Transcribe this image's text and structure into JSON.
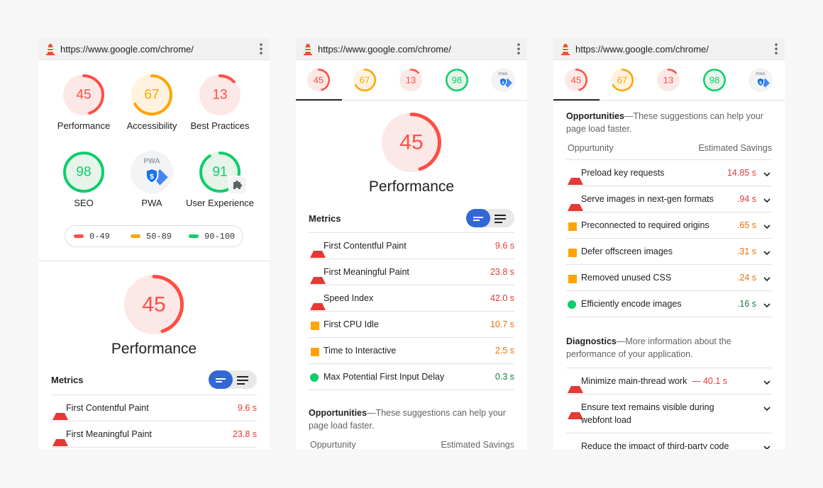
{
  "url": "https://www.google.com/chrome/",
  "colors": {
    "fail": "#ff4e42",
    "average": "#ffa400",
    "pass": "#0cce6b",
    "fail_bg": "#fce8e6",
    "average_bg": "#fff3e0",
    "pass_bg": "#e6f4ea",
    "toggle_active": "#3367d6"
  },
  "summary": {
    "gauges": [
      {
        "score": "45",
        "label": "Performance",
        "value": 0.45,
        "rating": "fail"
      },
      {
        "score": "67",
        "label": "Accessibility",
        "value": 0.67,
        "rating": "average"
      },
      {
        "score": "13",
        "label": "Best Practices",
        "value": 0.13,
        "rating": "fail"
      },
      {
        "score": "98",
        "label": "SEO",
        "value": 0.98,
        "rating": "pass"
      },
      {
        "label": "PWA",
        "badge": "PWA",
        "icon": "pwa-badge-icon"
      },
      {
        "score": "91",
        "label": "User Experience",
        "value": 0.91,
        "rating": "pass",
        "icon": "puzzle-plugin-icon"
      }
    ],
    "legend": [
      {
        "range": "0-49",
        "rating": "fail"
      },
      {
        "range": "50-89",
        "rating": "average"
      },
      {
        "range": "90-100",
        "rating": "pass"
      }
    ]
  },
  "tab_scores": [
    "45",
    "67",
    "13",
    "98"
  ],
  "tab_pwa_badge": "PWA",
  "performance": {
    "score": "45",
    "value": 0.45,
    "title": "Performance"
  },
  "metrics": {
    "heading": "Metrics",
    "items": [
      {
        "name": "First Contentful Paint",
        "value": "9.6 s",
        "rating": "fail"
      },
      {
        "name": "First Meaningful Paint",
        "value": "23.8 s",
        "rating": "fail"
      },
      {
        "name": "Speed Index",
        "value": "42.0 s",
        "rating": "fail"
      },
      {
        "name": "First CPU Idle",
        "value": "10.7 s",
        "rating": "average"
      },
      {
        "name": "Time to Interactive",
        "value": "2.5 s",
        "rating": "average"
      },
      {
        "name": "Max Potential First Input Delay",
        "value": "0.3 s",
        "rating": "pass"
      }
    ]
  },
  "opportunities": {
    "title": "Opportunities",
    "desc": "—These suggestions can help your page load faster.",
    "col_left": "Oppurtunity",
    "col_right": "Estimated Savings",
    "items": [
      {
        "name": "Preload key requests",
        "value": "14.85 s",
        "rating": "fail"
      },
      {
        "name": "Serve images in next-gen formats",
        "value": ".94 s",
        "rating": "fail"
      },
      {
        "name": "Preconnected to required origins",
        "value": ".65 s",
        "rating": "average"
      },
      {
        "name": "Defer offscreen images",
        "value": ".31 s",
        "rating": "average"
      },
      {
        "name": "Removed unused CSS",
        "value": ".24 s",
        "rating": "average"
      },
      {
        "name": "Efficiently encode images",
        "value": ".16 s",
        "rating": "pass"
      }
    ]
  },
  "diagnostics": {
    "title": "Diagnostics",
    "desc": "—More information about the performance of your application.",
    "items": [
      {
        "name": "Minimize main-thread work",
        "extra": " — 40.1 s",
        "rating": "fail"
      },
      {
        "name": "Ensure text remains visible during",
        "name2": "webfont load",
        "rating": "fail"
      },
      {
        "name": "Reduce the impact of third-party code",
        "rating": "fail"
      }
    ]
  }
}
